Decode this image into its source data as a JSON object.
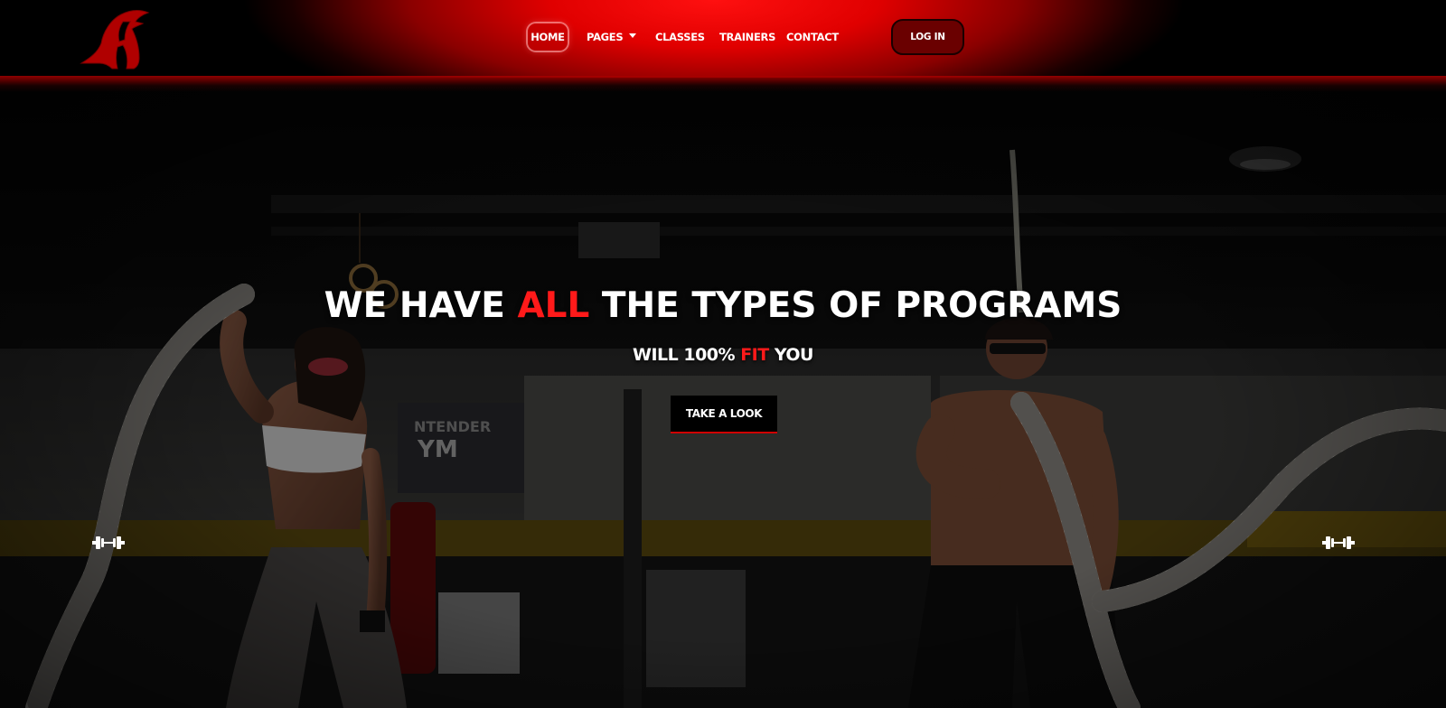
{
  "nav": {
    "items": [
      {
        "label": "HOME"
      },
      {
        "label": "PAGES"
      },
      {
        "label": "CLASSES"
      },
      {
        "label": "TRAINERS"
      },
      {
        "label": "CONTACT"
      }
    ],
    "login_label": "LOG IN"
  },
  "hero": {
    "title_before": "WE HAVE ",
    "title_accent": "ALL",
    "title_after": " THE TYPES OF PROGRAMS",
    "subtitle_before": "WILL 100% ",
    "subtitle_accent": "FIT",
    "subtitle_after": " YOU",
    "cta_label": "TAKE A LOOK"
  },
  "icons": {
    "logo": "spartan-helmet-icon",
    "carousel_left": "dumbbell-icon",
    "carousel_right": "dumbbell-icon"
  },
  "colors": {
    "brand_red": "#ff1a1a",
    "header_red": "#e00000",
    "background": "#000000"
  }
}
